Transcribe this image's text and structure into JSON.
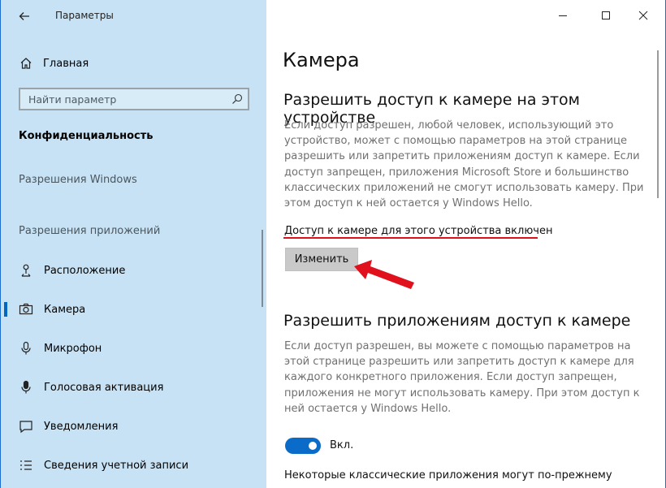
{
  "window": {
    "title": "Параметры"
  },
  "sidebar": {
    "home_label": "Главная",
    "search_placeholder": "Найти параметр",
    "section_title": "Конфиденциальность",
    "group1_label": "Разрешения Windows",
    "group2_label": "Разрешения приложений",
    "items": [
      {
        "label": "Расположение",
        "icon": "location-icon"
      },
      {
        "label": "Камера",
        "icon": "camera-icon",
        "active": true
      },
      {
        "label": "Микрофон",
        "icon": "microphone-icon"
      },
      {
        "label": "Голосовая активация",
        "icon": "voice-activation-icon"
      },
      {
        "label": "Уведомления",
        "icon": "notifications-icon"
      },
      {
        "label": "Сведения учетной записи",
        "icon": "account-info-icon"
      }
    ]
  },
  "content": {
    "title": "Камера",
    "section1": {
      "heading": "Разрешить доступ к камере на этом устройстве",
      "description": "Если доступ разрешен, любой человек, использующий это устройство, может с помощью параметров на этой странице разрешить или запретить приложениям доступ к камере. Если доступ запрещен, приложения Microsoft Store и большинство классических приложений не смогут использовать камеру. При этом доступ к ней остается у Windows Hello.",
      "status": "Доступ к камере для этого устройства включен",
      "change_button": "Изменить"
    },
    "section2": {
      "heading": "Разрешить приложениям доступ к камере",
      "description": "Если доступ разрешен, вы можете с помощью параметров на этой странице разрешить или запретить доступ к камере для каждого конкретного приложения. Если доступ запрещен, приложения не могут использовать камеру. При этом доступ к ней остается у Windows Hello.",
      "toggle_label": "Вкл.",
      "toggle_on": true,
      "footer_text": "Некоторые классические приложения могут по-прежнему"
    }
  },
  "colors": {
    "sidebar_bg": "#c7e2f4",
    "accent": "#0a6cc8",
    "annotation_red": "#e0101d"
  }
}
